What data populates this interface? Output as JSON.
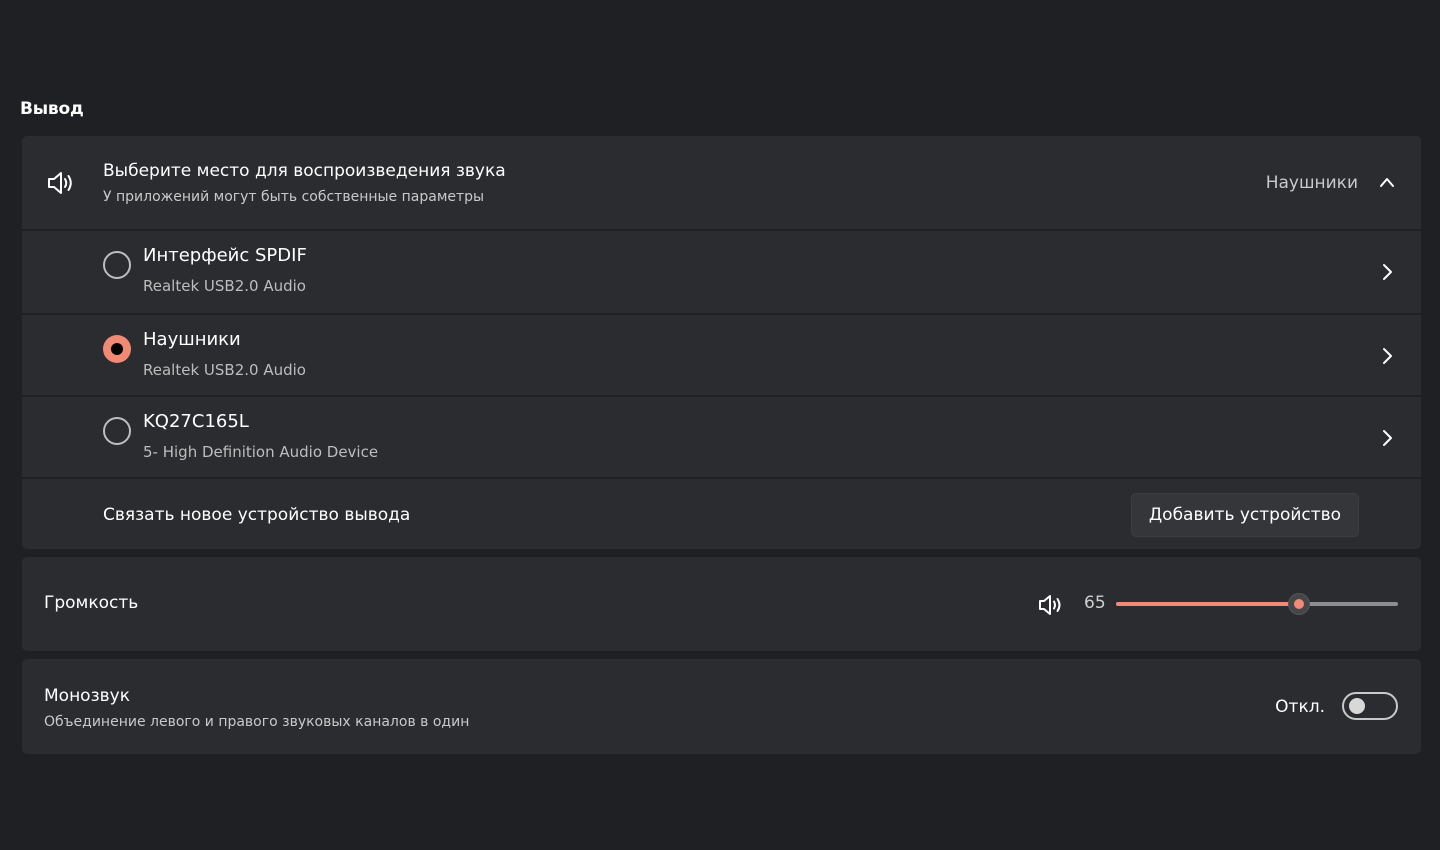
{
  "section_title": "Вывод",
  "output": {
    "title": "Выберите место для воспроизведения звука",
    "subtitle": "У приложений могут быть собственные параметры",
    "selected_value": "Наушники",
    "devices": [
      {
        "name": "Интерфейс SPDIF",
        "sub": "Realtek USB2.0 Audio",
        "selected": false
      },
      {
        "name": "Наушники",
        "sub": "Realtek USB2.0 Audio",
        "selected": true
      },
      {
        "name": "KQ27C165L",
        "sub": "5- High Definition Audio Device",
        "selected": false
      }
    ],
    "pair_label": "Связать новое устройство вывода",
    "add_button": "Добавить устройство"
  },
  "volume": {
    "label": "Громкость",
    "value": "65",
    "percent": 65
  },
  "mono": {
    "title": "Монозвук",
    "subtitle": "Объединение левого и правого звуковых каналов в один",
    "state_label": "Откл.",
    "enabled": false
  },
  "icons": {
    "output_header": "speaker-icon",
    "volume": "speaker-icon",
    "collapse": "chevron-up-icon",
    "device_open": "chevron-right-icon"
  },
  "colors": {
    "accent": "#f08a74",
    "background": "#1f2024",
    "card": "#2b2c30"
  }
}
